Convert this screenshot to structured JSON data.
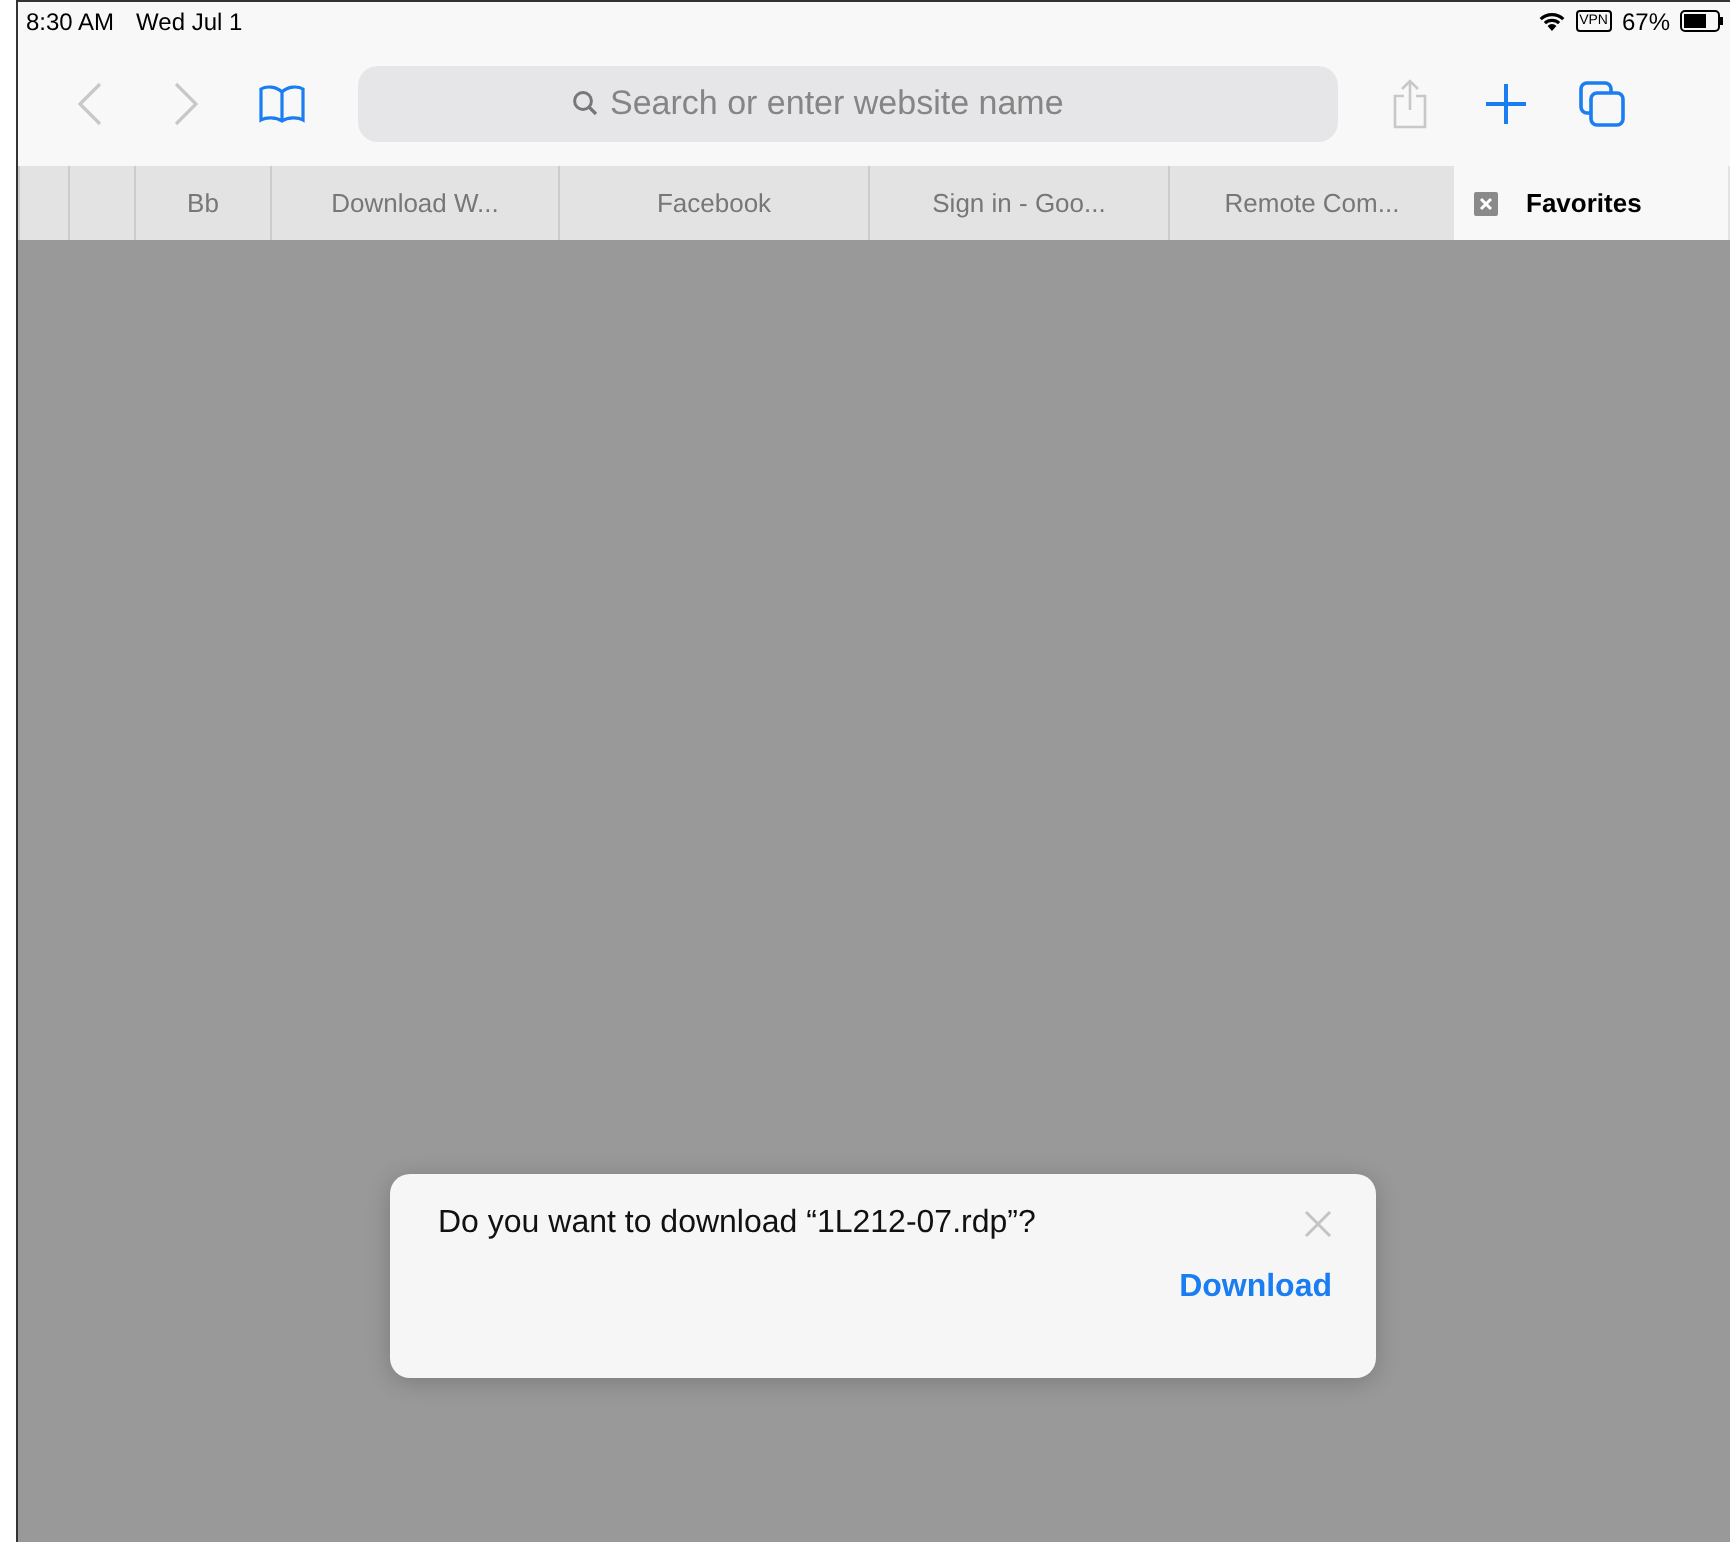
{
  "status_bar": {
    "time": "8:30 AM",
    "date": "Wed Jul 1",
    "vpn": "VPN",
    "battery": "67%"
  },
  "toolbar": {
    "buttons": [
      {
        "kind": "back",
        "disabled": true
      },
      {
        "kind": "forward",
        "disabled": true
      },
      {
        "kind": "bookmarks",
        "disabled": false
      }
    ],
    "address": {
      "placeholder": "Search or enter website name"
    },
    "actions": [
      {
        "kind": "share",
        "disabled": true
      },
      {
        "kind": "new-tab",
        "disabled": false
      },
      {
        "kind": "tabs",
        "disabled": false
      }
    ]
  },
  "tabs": [
    {
      "selected": false
    },
    {
      "selected": false
    },
    {
      "label": "Bb",
      "selected": false
    },
    {
      "label": "Download W...",
      "selected": false
    },
    {
      "label": "Facebook",
      "selected": false
    },
    {
      "label": "Sign in - Goo...",
      "selected": false
    },
    {
      "label": "Remote Com...",
      "selected": false
    },
    {
      "label": "Favorites",
      "selected": true
    }
  ],
  "dialog": {
    "message": "Do you want to download “1L212-07.rdp”?",
    "action": "Download"
  }
}
